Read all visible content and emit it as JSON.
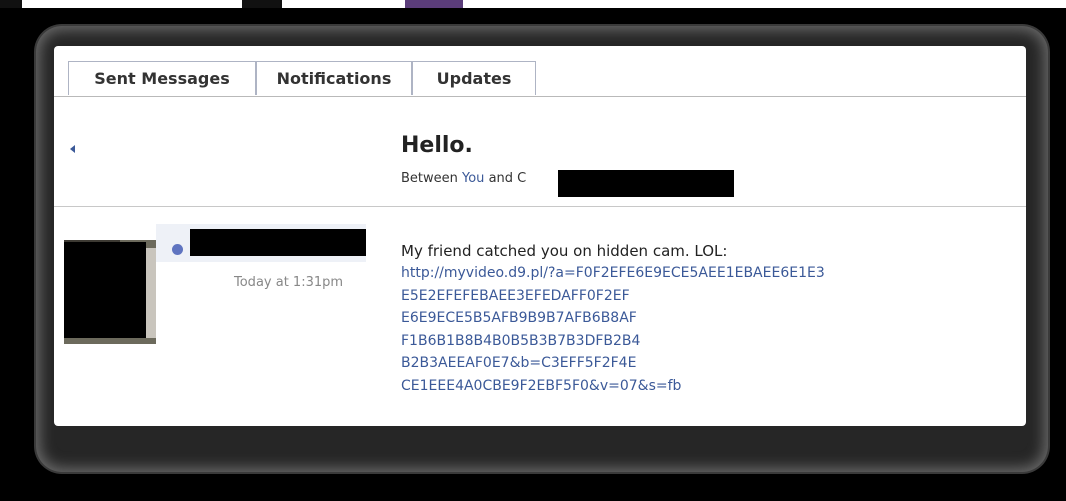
{
  "tabs": [
    {
      "label": "Sent Messages"
    },
    {
      "label": "Notifications"
    },
    {
      "label": "Updates"
    }
  ],
  "thread": {
    "title": "Hello.",
    "between_prefix": "Between ",
    "you": "You",
    "and_word": " and ",
    "other_initial": "C"
  },
  "message": {
    "timestamp": "Today at 1:31pm",
    "lead": "My friend catched you on hidden cam. LOL:",
    "link_lines": [
      "http://myvideo.d9.pl/?a=F0F2EFE6E9ECE5AEE1EBAEE6E1E3",
      "E5E2EFEFEBAEE3EFEDAFF0F2EF",
      "E6E9ECE5B5AFB9B9B7AFB6B8AF",
      "F1B6B1B8B4B0B5B3B7B3DFB2B4",
      "B2B3AEEAF0E7&b=C3EFF5F2F4E",
      "CE1EEE4A0CBE9F2EBF5F0&v=07&s=fb"
    ]
  },
  "colors": {
    "link": "#3b5998",
    "unread_dot": "#5f74c0"
  }
}
